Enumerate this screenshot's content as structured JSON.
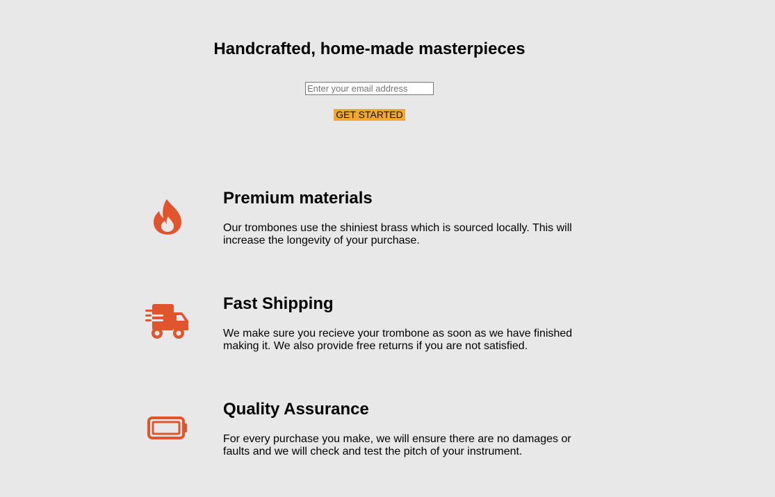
{
  "hero": {
    "title": "Handcrafted, home-made masterpieces",
    "email_placeholder": "Enter your email address",
    "cta_label": "GET STARTED"
  },
  "colors": {
    "background": "#e8e8e8",
    "accent": "#f0a82e",
    "icon": "#e0552b"
  },
  "features": [
    {
      "icon": "fire-icon",
      "title": "Premium materials",
      "text": "Our trombones use the shiniest brass which is sourced locally. This will increase the longevity of your purchase."
    },
    {
      "icon": "truck-icon",
      "title": "Fast Shipping",
      "text": "We make sure you recieve your trombone as soon as we have finished making it. We also provide free returns if you are not satisfied."
    },
    {
      "icon": "battery-icon",
      "title": "Quality Assurance",
      "text": "For every purchase you make, we will ensure there are no damages or faults and we will check and test the pitch of your instrument."
    }
  ]
}
